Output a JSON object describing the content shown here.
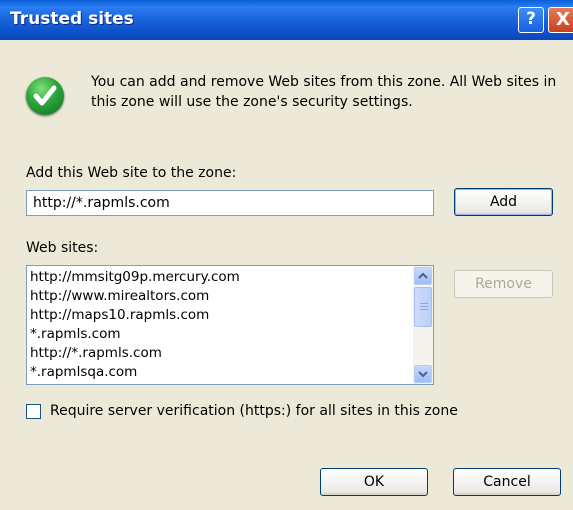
{
  "dialog": {
    "title": "Trusted sites",
    "help_label": "?",
    "close_label": "X",
    "info_text": "You can add and remove Web sites from this zone. All Web sites in this zone will use the zone's security settings.",
    "add_label": "Add this Web site to the zone:",
    "add_input_value": "http://*.rapmls.com",
    "add_button": "Add",
    "websites_label": "Web sites:",
    "websites": [
      "http://mmsitg09p.mercury.com",
      "http://www.mirealtors.com",
      "http://maps10.rapmls.com",
      "*.rapmls.com",
      "http://*.rapmls.com",
      "*.rapmlsqa.com"
    ],
    "remove_button": "Remove",
    "require_https_label": "Require server verification (https:) for all sites in this zone",
    "require_https_checked": false,
    "ok_button": "OK",
    "cancel_button": "Cancel"
  },
  "colors": {
    "titlebar": "#0a5fd8",
    "dialog_bg": "#ece9d8",
    "field_border": "#7f9db9",
    "info_icon": "#2aa43a"
  },
  "icons": {
    "info": "checkmark-icon",
    "scroll_up": "chevron-up-icon",
    "scroll_down": "chevron-down-icon"
  }
}
